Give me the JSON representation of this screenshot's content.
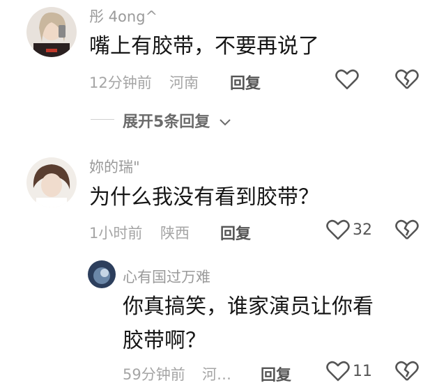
{
  "comments": [
    {
      "username": "彤 4ong^",
      "text": "嘴上有胶带，不要再说了",
      "time": "12分钟前",
      "location": "河南",
      "reply_label": "回复",
      "like_count": "",
      "expand_label": "展开5条回复"
    },
    {
      "username": "妳的瑞\"",
      "text": "为什么我没有看到胶带？",
      "time": "1小时前",
      "location": "陕西",
      "reply_label": "回复",
      "like_count": "32"
    },
    {
      "username": "心有国过万难",
      "text_line1": "你真搞笑，谁家演员让你看",
      "text_line2": "胶带啊？",
      "time": "59分钟前",
      "location": "河…",
      "reply_label": "回复",
      "like_count": "11"
    }
  ],
  "colors": {
    "meta": "#a5a5a5",
    "username": "#9a9a9a",
    "text": "#161616"
  },
  "icons": [
    "heart-icon",
    "broken-heart-icon",
    "chevron-down-icon"
  ]
}
